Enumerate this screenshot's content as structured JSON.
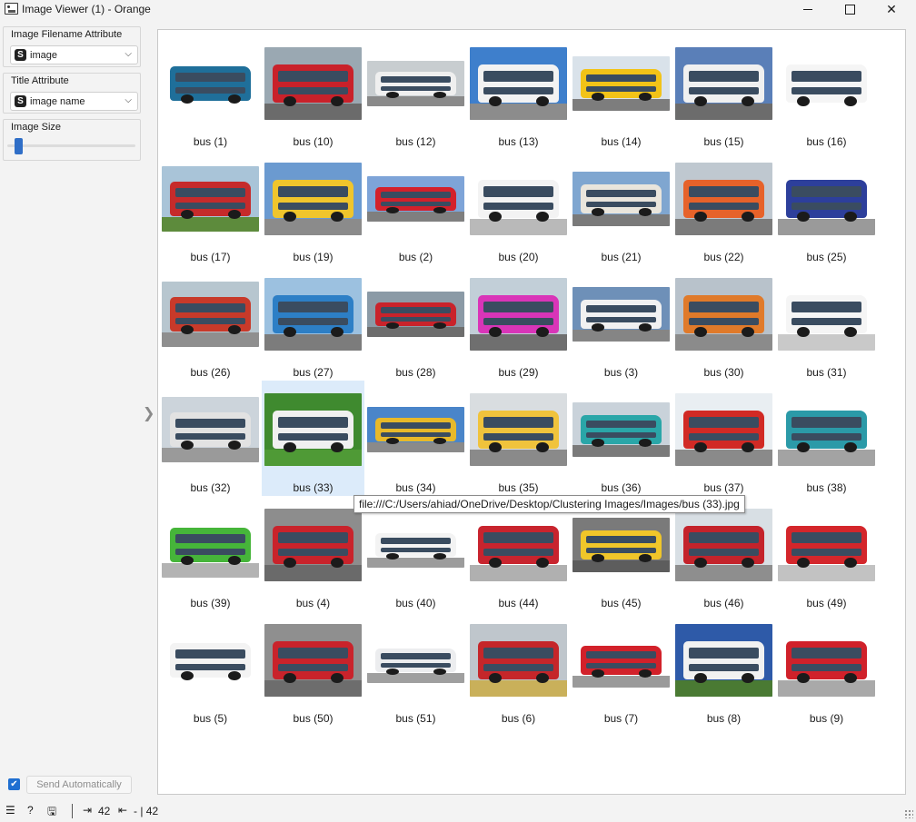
{
  "window": {
    "title": "Image Viewer (1) - Orange"
  },
  "left_panel": {
    "filename_attr": {
      "label": "Image Filename Attribute",
      "badge": "S",
      "value": "image"
    },
    "title_attr": {
      "label": "Title Attribute",
      "badge": "S",
      "value": "image name"
    },
    "image_size": {
      "label": "Image Size",
      "level": 0.05
    },
    "send_auto": {
      "checked": true,
      "label": "Send Automatically"
    }
  },
  "statusbar": {
    "input_count": "42",
    "output_count": "- | 42"
  },
  "tooltip": "file:///C:/Users/ahiad/OneDrive/Desktop/Clustering Images/Images/bus (33).jpg",
  "grid": {
    "selected": "bus (33)",
    "items": [
      {
        "name": "bus (1)",
        "color": "#1f6f9a",
        "sky": "#ffffff",
        "ground": "#ffffff"
      },
      {
        "name": "bus (10)",
        "color": "#c9212a",
        "sky": "#9aa8b2",
        "ground": "#6b6b6b"
      },
      {
        "name": "bus (12)",
        "color": "#efefef",
        "sky": "#c8cdd0",
        "ground": "#8a8a8a"
      },
      {
        "name": "bus (13)",
        "color": "#f2f2f2",
        "sky": "#3e7fcc",
        "ground": "#8c8c8c"
      },
      {
        "name": "bus (14)",
        "color": "#f2c318",
        "sky": "#d9e2ea",
        "ground": "#7d7d7d"
      },
      {
        "name": "bus (15)",
        "color": "#f0f0f0",
        "sky": "#5a7fb8",
        "ground": "#6c6c6c"
      },
      {
        "name": "bus (16)",
        "color": "#f5f5f5",
        "sky": "#ffffff",
        "ground": "#ffffff"
      },
      {
        "name": "bus (17)",
        "color": "#c62b2b",
        "sky": "#a9c4d8",
        "ground": "#5d8b3c"
      },
      {
        "name": "bus (19)",
        "color": "#f0c52c",
        "sky": "#6b9ad0",
        "ground": "#8b8b8b"
      },
      {
        "name": "bus (2)",
        "color": "#d3212b",
        "sky": "#7ea4d8",
        "ground": "#7f7f7f"
      },
      {
        "name": "bus (20)",
        "color": "#f3f3f3",
        "sky": "#ffffff",
        "ground": "#b9b9b9"
      },
      {
        "name": "bus (21)",
        "color": "#e9e5dc",
        "sky": "#7fa6d0",
        "ground": "#7a7a7a"
      },
      {
        "name": "bus (22)",
        "color": "#e6622a",
        "sky": "#bfc8d0",
        "ground": "#7b7b7b"
      },
      {
        "name": "bus (25)",
        "color": "#2d3f9b",
        "sky": "#ffffff",
        "ground": "#9a9a9a"
      },
      {
        "name": "bus (26)",
        "color": "#c83a2a",
        "sky": "#b7c6cf",
        "ground": "#8f8f8f"
      },
      {
        "name": "bus (27)",
        "color": "#2d7fc6",
        "sky": "#9cc1e0",
        "ground": "#7c7c7c"
      },
      {
        "name": "bus (28)",
        "color": "#c9232b",
        "sky": "#8b9aa6",
        "ground": "#6d6d6d"
      },
      {
        "name": "bus (29)",
        "color": "#d935b8",
        "sky": "#c2cfd8",
        "ground": "#6f6f6f"
      },
      {
        "name": "bus (3)",
        "color": "#f1f1f1",
        "sky": "#6e90b8",
        "ground": "#858585"
      },
      {
        "name": "bus (30)",
        "color": "#e07a2a",
        "sky": "#b8c2cb",
        "ground": "#8b8b8b"
      },
      {
        "name": "bus (31)",
        "color": "#f5f5f5",
        "sky": "#ffffff",
        "ground": "#c9c9c9"
      },
      {
        "name": "bus (32)",
        "color": "#e2e2e2",
        "sky": "#ccd4db",
        "ground": "#9a9a9a"
      },
      {
        "name": "bus (33)",
        "color": "#f0f0f0",
        "sky": "#3f8a2f",
        "ground": "#4f9a36"
      },
      {
        "name": "bus (34)",
        "color": "#e8b92a",
        "sky": "#4a85c9",
        "ground": "#8a8a8a"
      },
      {
        "name": "bus (35)",
        "color": "#f0c33c",
        "sky": "#d9dde0",
        "ground": "#8a8a8a"
      },
      {
        "name": "bus (36)",
        "color": "#2aa6a8",
        "sky": "#c9d2da",
        "ground": "#7a7a7a"
      },
      {
        "name": "bus (37)",
        "color": "#d12a25",
        "sky": "#e9eef2",
        "ground": "#8a8a8a"
      },
      {
        "name": "bus (38)",
        "color": "#2b9aa8",
        "sky": "#ffffff",
        "ground": "#a3a3a3"
      },
      {
        "name": "bus (39)",
        "color": "#46b53a",
        "sky": "#ffffff",
        "ground": "#b3b3b3"
      },
      {
        "name": "bus (4)",
        "color": "#c9232b",
        "sky": "#8d8d8d",
        "ground": "#6a6a6a"
      },
      {
        "name": "bus (40)",
        "color": "#f3f3f3",
        "sky": "#ffffff",
        "ground": "#9c9c9c"
      },
      {
        "name": "bus (44)",
        "color": "#c8242e",
        "sky": "#ffffff",
        "ground": "#b0b0b0"
      },
      {
        "name": "bus (45)",
        "color": "#f0c62a",
        "sky": "#7a7a7a",
        "ground": "#5d5d5d"
      },
      {
        "name": "bus (46)",
        "color": "#c4232b",
        "sky": "#d8dfe4",
        "ground": "#8e8e8e"
      },
      {
        "name": "bus (49)",
        "color": "#d4262b",
        "sky": "#ffffff",
        "ground": "#c2c2c2"
      },
      {
        "name": "bus (5)",
        "color": "#f3f3f3",
        "sky": "#ffffff",
        "ground": "#ffffff"
      },
      {
        "name": "bus (50)",
        "color": "#c9232b",
        "sky": "#8f8f8f",
        "ground": "#6d6d6d"
      },
      {
        "name": "bus (51)",
        "color": "#ecedef",
        "sky": "#ffffff",
        "ground": "#9f9f9f"
      },
      {
        "name": "bus (6)",
        "color": "#c5262a",
        "sky": "#bfc6cc",
        "ground": "#c9b05a"
      },
      {
        "name": "bus (7)",
        "color": "#d2212a",
        "sky": "#ffffff",
        "ground": "#9a9a9a"
      },
      {
        "name": "bus (8)",
        "color": "#f1f1f1",
        "sky": "#2e5aa8",
        "ground": "#4a7a33"
      },
      {
        "name": "bus (9)",
        "color": "#d0212a",
        "sky": "#ffffff",
        "ground": "#a9a9a9"
      }
    ]
  }
}
